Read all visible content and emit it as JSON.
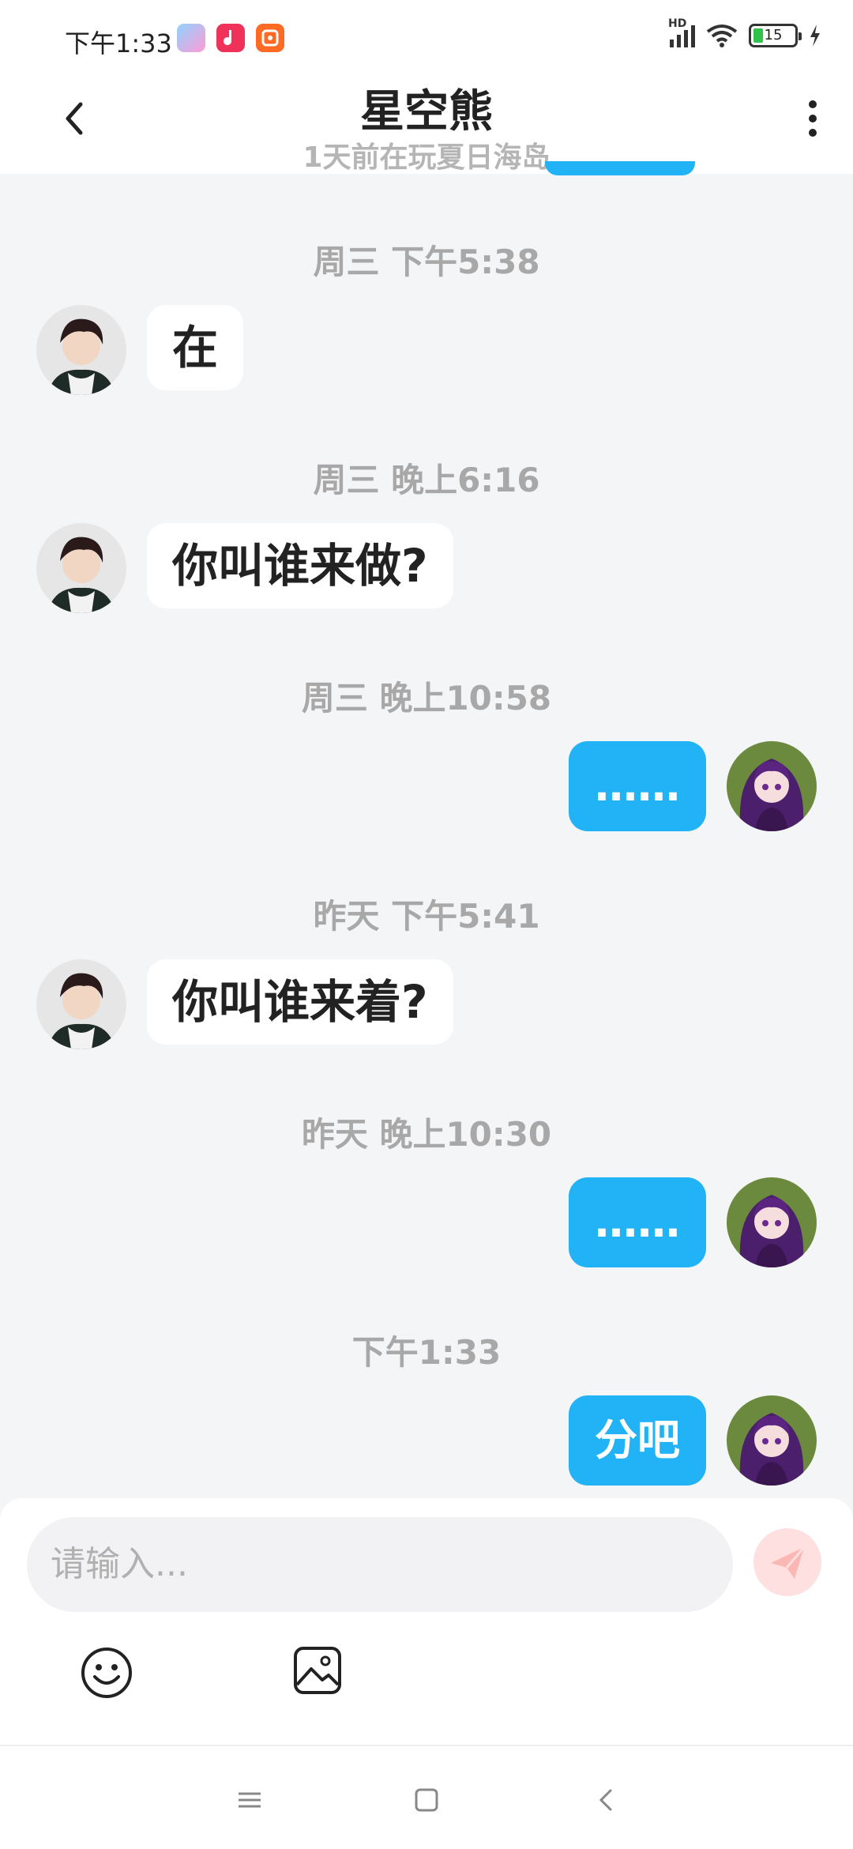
{
  "status_bar": {
    "time": "下午1:33",
    "hd_label": "HD",
    "battery_level": "15"
  },
  "header": {
    "title": "星空熊",
    "subtitle": "1天前在玩夏日海岛"
  },
  "messages": [
    {
      "timestamp": "周三 下午5:38",
      "side": "in",
      "text": "在"
    },
    {
      "timestamp": "周三 晚上6:16",
      "side": "in",
      "text": "你叫谁来做?"
    },
    {
      "timestamp": "周三 晚上10:58",
      "side": "out",
      "text": "……"
    },
    {
      "timestamp": "昨天 下午5:41",
      "side": "in",
      "text": "你叫谁来着?"
    },
    {
      "timestamp": "昨天 晚上10:30",
      "side": "out",
      "text": "……"
    },
    {
      "timestamp": "下午1:33",
      "side": "out",
      "text": "分吧"
    }
  ],
  "input": {
    "placeholder": "请输入..."
  },
  "colors": {
    "accent": "#22b2f6",
    "send_disabled": "#fde0df"
  }
}
